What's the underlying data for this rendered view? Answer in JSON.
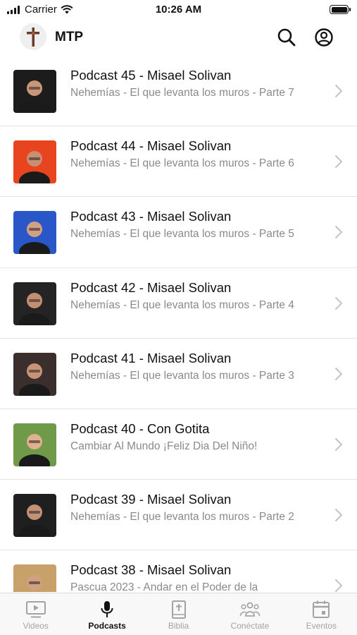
{
  "status_bar": {
    "carrier": "Carrier",
    "time": "10:26 AM"
  },
  "header": {
    "title": "MTP"
  },
  "podcasts": [
    {
      "title": "Podcast 45 - Misael Solivan",
      "subtitle": "Nehemías - El que levanta los muros - Parte 7",
      "thumb_bg": "#1c1c1c",
      "thumb_face": "#c9967a"
    },
    {
      "title": "Podcast 44 - Misael Solivan",
      "subtitle": "Nehemías - El que levanta los muros - Parte 6",
      "thumb_bg": "#e8441f",
      "thumb_face": "#c98f74"
    },
    {
      "title": "Podcast 43 - Misael Solivan",
      "subtitle": "Nehemías - El que levanta los muros - Parte 5",
      "thumb_bg": "#2a57c8",
      "thumb_face": "#d2a083"
    },
    {
      "title": "Podcast 42 - Misael Solivan",
      "subtitle": "Nehemías - El que levanta los muros - Parte 4",
      "thumb_bg": "#242424",
      "thumb_face": "#c48e72"
    },
    {
      "title": "Podcast 41 - Misael Solivan",
      "subtitle": "Nehemías - El que levanta los muros - Parte 3",
      "thumb_bg": "#3a2f2c",
      "thumb_face": "#c99378"
    },
    {
      "title": "Podcast 40 - Con Gotita",
      "subtitle": "Cambiar Al Mundo ¡Feliz Dia Del Niño!",
      "thumb_bg": "#6f9a4a",
      "thumb_face": "#e0b08f"
    },
    {
      "title": "Podcast 39 - Misael Solivan",
      "subtitle": "Nehemías - El que levanta los muros - Parte 2",
      "thumb_bg": "#1f1f1f",
      "thumb_face": "#c59175"
    },
    {
      "title": "Podcast 38 - Misael Solivan",
      "subtitle": "Pascua 2023 - Andar en el Poder de la",
      "thumb_bg": "#c8a06a",
      "thumb_face": "#d1a080"
    }
  ],
  "tabs": [
    {
      "label": "Videos",
      "icon": "video-icon",
      "active": false
    },
    {
      "label": "Podcasts",
      "icon": "microphone-icon",
      "active": true
    },
    {
      "label": "Biblia",
      "icon": "bible-icon",
      "active": false
    },
    {
      "label": "Conéctate",
      "icon": "people-icon",
      "active": false
    },
    {
      "label": "Eventos",
      "icon": "calendar-icon",
      "active": false
    }
  ]
}
